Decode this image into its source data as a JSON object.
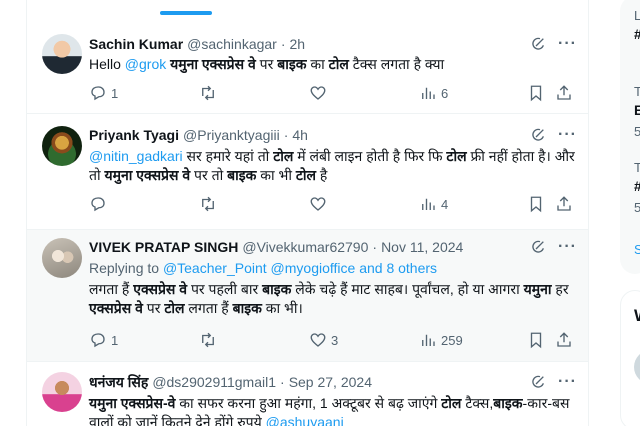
{
  "tweets": [
    {
      "name": "Sachin Kumar",
      "handle": "@sachinkagar",
      "time": "2h",
      "body_html": "Hello <span class=\"mention\">@grok</span> <b>यमुना एक्सप्रेस वे</b> पर <b>बाइक</b> का <b>टोल</b> टैक्स लगता है क्या",
      "reply_count": "1",
      "retweet_count": "",
      "like_count": "",
      "view_count": "6"
    },
    {
      "name": "Priyank Tyagi",
      "handle": "@Priyanktyagiii",
      "time": "4h",
      "body_html": "<span class=\"mention\">@nitin_gadkari</span> सर हमारे यहां तो <b>टोल</b> में लंबी लाइन होती है फिर फि <b>टोल</b> फ्री नहीं होता है। और तो <b>यमुना एक्सप्रेस वे</b> पर तो <b>बाइक</b> का भी <b>टोल</b> है",
      "reply_count": "",
      "retweet_count": "",
      "like_count": "",
      "view_count": "4"
    },
    {
      "name": "VIVEK PRATAP SINGH",
      "handle": "@Vivekkumar62790",
      "time": "Nov 11, 2024",
      "replying_prefix": "Replying to",
      "replying_user1": "@Teacher_Point",
      "replying_user2": "@myogioffice",
      "replying_suffix": "and 8 others",
      "body_html": "लगता हैं <b>एक्सप्रेस वे</b> पर पहली बार <b>बाइक</b> लेके चढ़े हैं माट साहब। पूर्वांचल, हो या आगरा <b>यमुना</b> हर <b>एक्सप्रेस वे</b> पर <b>टोल</b> लगता हैं <b>बाइक</b> का भी।",
      "reply_count": "1",
      "retweet_count": "",
      "like_count": "3",
      "view_count": "259"
    },
    {
      "name": "धनंजय सिंह",
      "handle": "@ds2902911gmail1",
      "time": "Sep 27, 2024",
      "body_html": "<b>यमुना एक्सप्रेस-वे</b> का सफर करना हुआ महंगा, 1 अक्टूबर से बढ़ जाएंगे <b>टोल</b> टैक्स,<b>बाइक</b>-कार-बस वालों को जानें कितने देने होंगे रुपये <span class=\"mention\">@ashuyaani</span>"
    }
  ],
  "sidebar": {
    "fragments": [
      "L",
      "#",
      "T",
      "E",
      "5",
      "T",
      "#",
      "5",
      "S",
      "W"
    ]
  },
  "colors": {
    "accent": "#1d9bf0",
    "muted": "#536471",
    "text": "#0f1419",
    "border": "#eff3f4"
  }
}
